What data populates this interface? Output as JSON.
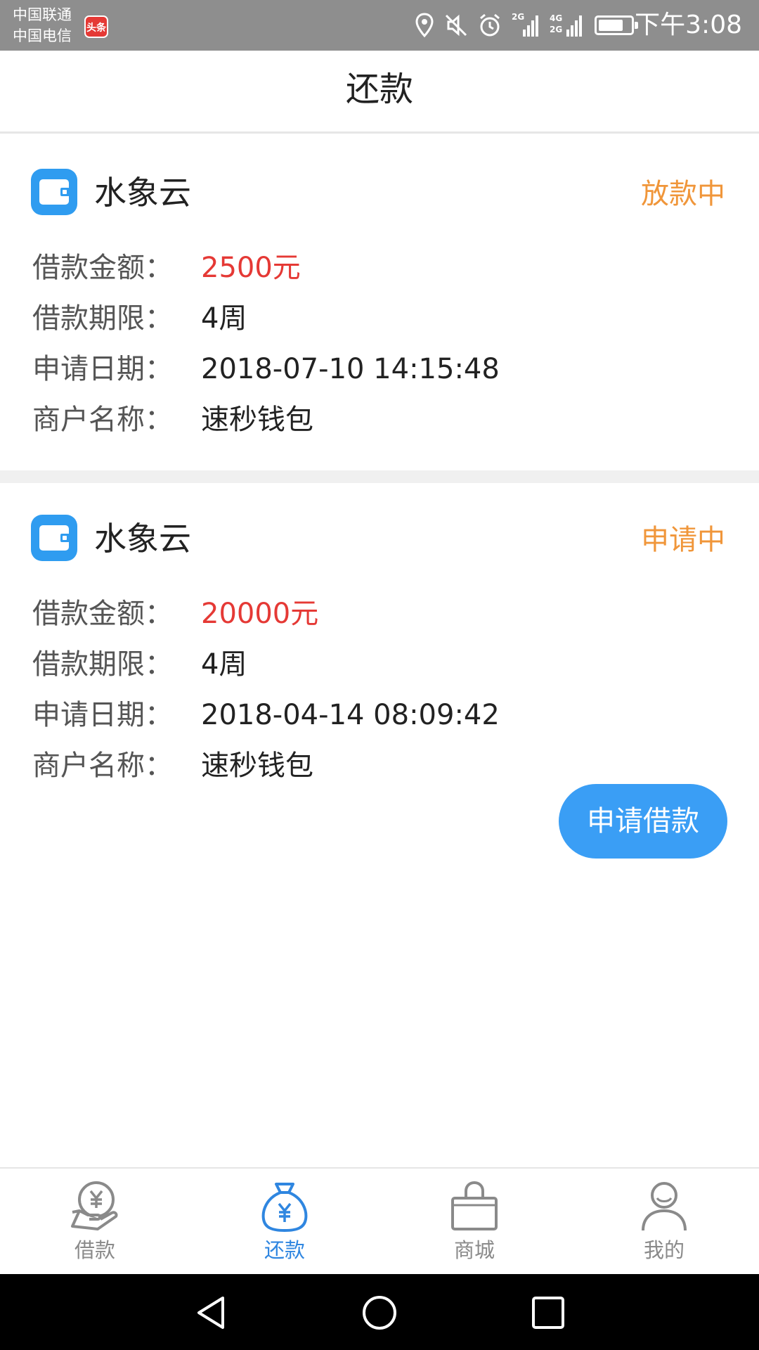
{
  "status_bar": {
    "carrier_1": "中国联通",
    "carrier_2": "中国电信",
    "badge": "头条",
    "net_1": "2G",
    "net_2": "4G",
    "net_3": "2G",
    "battery_level": 0.7,
    "time": "下午3:08"
  },
  "header": {
    "title": "还款"
  },
  "loans": [
    {
      "icon": "wallet-icon",
      "company": "水象云",
      "status": "放款中",
      "amount_label": "借款金额：",
      "amount": "2500元",
      "term_label": "借款期限：",
      "term": "4周",
      "date_label": "申请日期：",
      "date": "2018-07-10 14:15:48",
      "merchant_label": "商户名称：",
      "merchant": "速秒钱包"
    },
    {
      "icon": "wallet-icon",
      "company": "水象云",
      "status": "申请中",
      "amount_label": "借款金额：",
      "amount": "20000元",
      "term_label": "借款期限：",
      "term": "4周",
      "date_label": "申请日期：",
      "date": "2018-04-14 08:09:42",
      "merchant_label": "商户名称：",
      "merchant": "速秒钱包"
    }
  ],
  "apply_button": "申请借款",
  "tabs": [
    {
      "label": "借款",
      "icon": "hand-coin-icon",
      "active": false
    },
    {
      "label": "还款",
      "icon": "money-bag-icon",
      "active": true
    },
    {
      "label": "商城",
      "icon": "shopping-bag-icon",
      "active": false
    },
    {
      "label": "我的",
      "icon": "person-icon",
      "active": false
    }
  ],
  "colors": {
    "accent": "#2f86e0",
    "status_orange": "#f0963a",
    "amount_red": "#e53935",
    "button_blue": "#3a9ef5"
  }
}
